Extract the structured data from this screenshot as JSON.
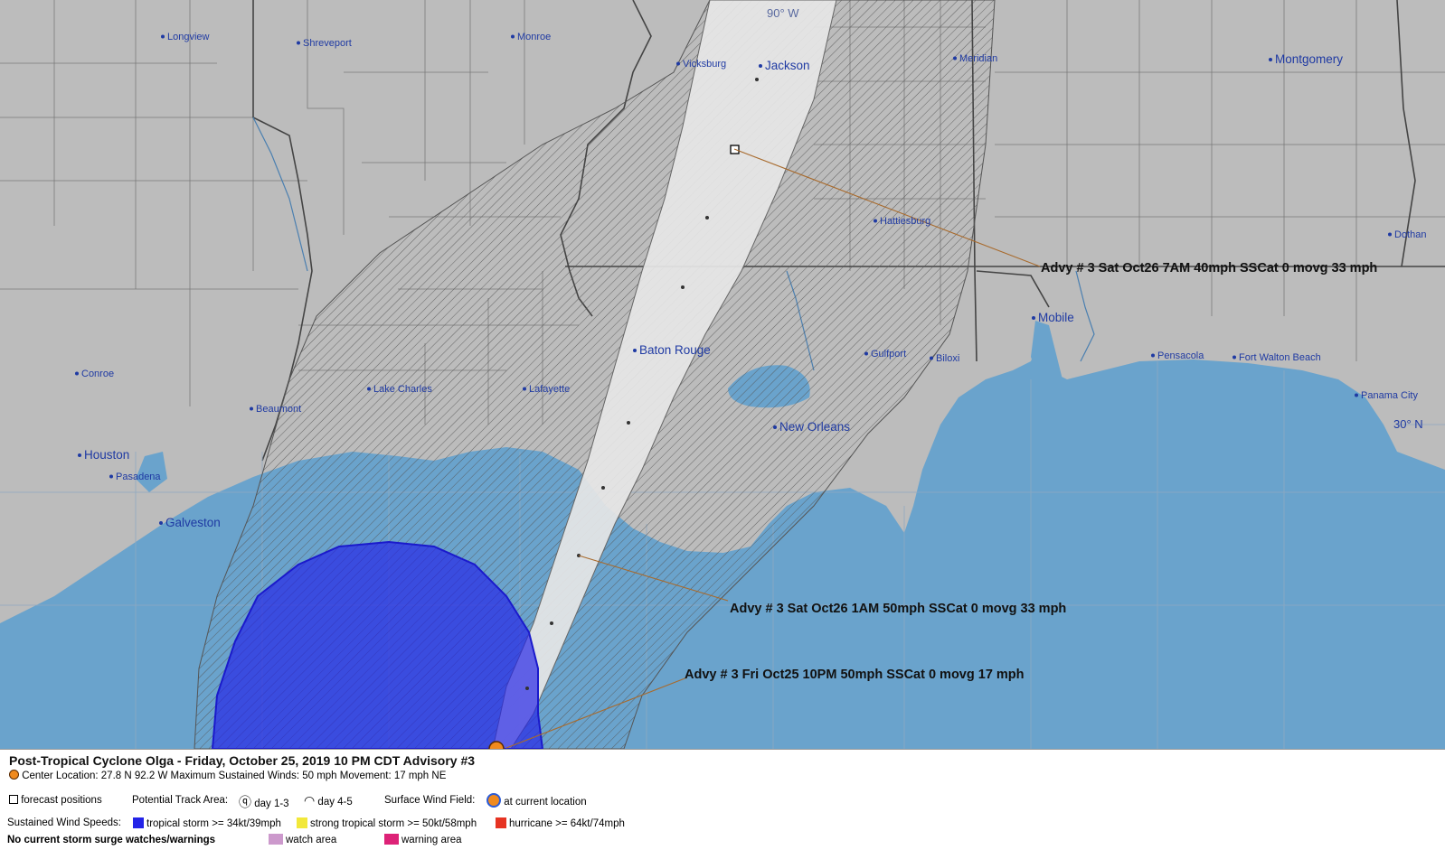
{
  "map": {
    "longitude_label": "90° W",
    "latitude_label": "30° N",
    "cities": [
      {
        "name": "Longview",
        "big": false
      },
      {
        "name": "Shreveport",
        "big": false
      },
      {
        "name": "Monroe",
        "big": false
      },
      {
        "name": "Vicksburg",
        "big": false
      },
      {
        "name": "Jackson",
        "big": true
      },
      {
        "name": "Meridian",
        "big": false
      },
      {
        "name": "Montgomery",
        "big": true
      },
      {
        "name": "Hattiesburg",
        "big": false
      },
      {
        "name": "Dothan",
        "big": false
      },
      {
        "name": "Mobile",
        "big": true
      },
      {
        "name": "Conroe",
        "big": false
      },
      {
        "name": "Baton Rouge",
        "big": true
      },
      {
        "name": "Gulfport",
        "big": false
      },
      {
        "name": "Biloxi",
        "big": false
      },
      {
        "name": "Pensacola",
        "big": false
      },
      {
        "name": "Fort Walton Beach",
        "big": false
      },
      {
        "name": "Panama City",
        "big": false
      },
      {
        "name": "Lake Charles",
        "big": false
      },
      {
        "name": "Lafayette",
        "big": false
      },
      {
        "name": "Beaumont",
        "big": false
      },
      {
        "name": "New Orleans",
        "big": true
      },
      {
        "name": "Houston",
        "big": true
      },
      {
        "name": "Pasadena",
        "big": false
      },
      {
        "name": "Galveston",
        "big": true
      }
    ],
    "advisories": [
      "Advy # 3 Sat Oct26 7AM  40mph SSCat 0 movg 33 mph",
      "Advy # 3 Sat Oct26 1AM  50mph SSCat 0 movg 33 mph",
      "Advy # 3 Fri Oct25 10PM  50mph SSCat 0 movg 17 mph"
    ]
  },
  "legend": {
    "title": "Post-Tropical Cyclone Olga  -  Friday, October 25, 2019  10 PM CDT   Advisory #3",
    "center_info": "Center Location: 27.8 N  92.2 W   Maximum Sustained Winds: 50 mph  Movement: 17 mph NE",
    "forecast_positions": "forecast positions",
    "potential_track_area": "Potential Track Area:",
    "day_1_3": "day 1-3",
    "day_4_5": "day 4-5",
    "surface_wind_field": "Surface Wind Field:",
    "at_current_location": "at current location",
    "sustained_wind_speeds": "Sustained Wind Speeds:",
    "tropical_storm": "tropical storm >= 34kt/39mph",
    "strong_tropical_storm": "strong tropical storm >= 50kt/58mph",
    "hurricane": "hurricane >= 64kt/74mph",
    "surge_note": "No current storm surge watches/warnings",
    "watch_area": "watch area",
    "warning_area": "warning area"
  },
  "colors": {
    "land": "#bcbcbc",
    "water": "#6aa3cc",
    "cone": "#dedede",
    "tropical_storm": "#2424e8",
    "strong_tropical_storm": "#f2e83a",
    "hurricane": "#e63322",
    "watch": "#cc99cc",
    "warning": "#dd2277"
  }
}
